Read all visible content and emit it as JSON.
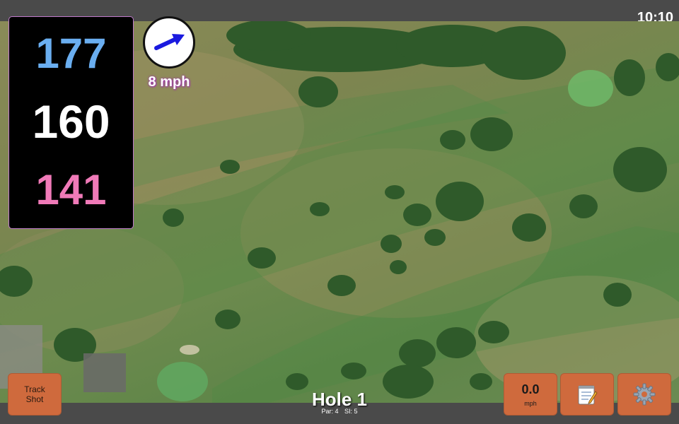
{
  "status": {
    "time": "10:10"
  },
  "distances": {
    "back": "177",
    "center": "160",
    "front": "141"
  },
  "wind": {
    "speed": "8 mph",
    "direction_icon": "wind-arrow-icon",
    "arrow_color": "#1a1adf"
  },
  "hole": {
    "title": "Hole 1",
    "par": "Par: 4",
    "stroke_index": "SI: 5"
  },
  "buttons": {
    "track_shot": {
      "line1": "Track",
      "line2": "Shot"
    },
    "speed": {
      "value": "0.0",
      "unit": "mph"
    },
    "notes": {
      "icon": "notepad-icon"
    },
    "settings": {
      "icon": "gear-icon"
    }
  },
  "colors": {
    "back_distance": "#6aaef0",
    "center_distance": "#ffffff",
    "front_distance": "#f07ab8",
    "button": "#cf6a3d",
    "bar": "#4a4a4a"
  }
}
